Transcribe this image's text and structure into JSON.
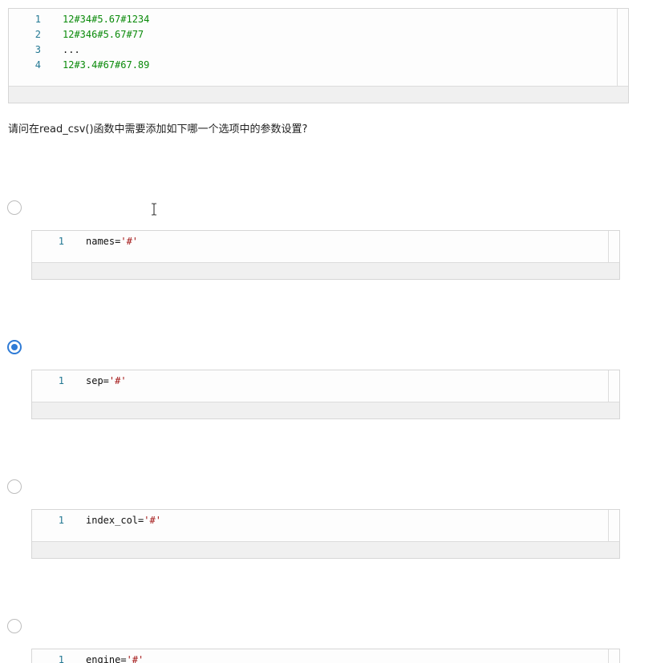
{
  "data_snippet": {
    "lines": [
      {
        "num": "1",
        "text": "12#34#5.67#1234"
      },
      {
        "num": "2",
        "text": "12#346#5.67#77"
      },
      {
        "num": "3",
        "text": "..."
      },
      {
        "num": "4",
        "text": "12#3.4#67#67.89"
      }
    ]
  },
  "question": {
    "text": "请问在read_csv()函数中需要添加如下哪一个选项中的参数设置?"
  },
  "options": [
    {
      "num": "1",
      "param": "names=",
      "value": "'#'",
      "selected": false
    },
    {
      "num": "1",
      "param": "sep=",
      "value": "'#'",
      "selected": true
    },
    {
      "num": "1",
      "param": "index_col=",
      "value": "'#'",
      "selected": false
    },
    {
      "num": "1",
      "param": "engine=",
      "value": "'#'",
      "selected": false
    }
  ],
  "colors": {
    "accent": "#2f7bd6",
    "line_number": "#237893",
    "data_text": "#0a8a0a",
    "string": "#a31515"
  }
}
